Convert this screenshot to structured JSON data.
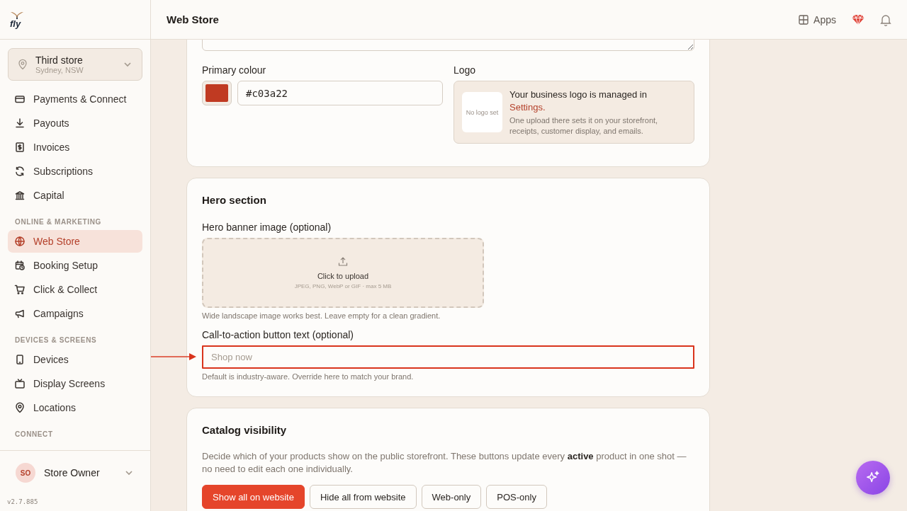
{
  "sidebar": {
    "brand": "fly",
    "store_selector": {
      "name": "Third store",
      "location": "Sydney, NSW"
    },
    "sections": [
      {
        "items": [
          {
            "label": "Payments & Connect",
            "selected": false
          },
          {
            "label": "Payouts",
            "selected": false
          },
          {
            "label": "Invoices",
            "selected": false
          },
          {
            "label": "Subscriptions",
            "selected": false
          },
          {
            "label": "Capital",
            "selected": false
          }
        ]
      },
      {
        "heading": "ONLINE & MARKETING",
        "items": [
          {
            "label": "Web Store",
            "selected": true
          },
          {
            "label": "Booking Setup",
            "selected": false
          },
          {
            "label": "Click & Collect",
            "selected": false
          },
          {
            "label": "Campaigns",
            "selected": false
          }
        ]
      },
      {
        "heading": "DEVICES & SCREENS",
        "items": [
          {
            "label": "Devices",
            "selected": false
          },
          {
            "label": "Display Screens",
            "selected": false
          },
          {
            "label": "Locations",
            "selected": false
          }
        ]
      },
      {
        "heading": "CONNECT"
      }
    ],
    "user": {
      "initials": "SO",
      "name": "Store Owner"
    },
    "version": "v2.7.885"
  },
  "header": {
    "title": "Web Store",
    "apps_label": "Apps"
  },
  "branding_card": {
    "primary_colour": {
      "label": "Primary colour",
      "value": "#c03a22",
      "color": "#c03a22"
    },
    "logo": {
      "label": "Logo",
      "placeholder": "No logo set",
      "message": "Your business logo is managed in",
      "link": "Settings.",
      "note": "One upload there sets it on your storefront, receipts, customer display, and emails."
    }
  },
  "hero_card": {
    "title": "Hero section",
    "banner": {
      "label": "Hero banner image (optional)",
      "action": "Click to upload",
      "hint": "JPEG, PNG, WebP or GIF · max 5 MB",
      "help": "Wide landscape image works best. Leave empty for a clean gradient."
    },
    "cta": {
      "label": "Call-to-action button text (optional)",
      "placeholder": "Shop now",
      "highlighted": true,
      "help": "Default is industry-aware. Override here to match your brand."
    }
  },
  "catalog_card": {
    "title": "Catalog visibility",
    "description": "Decide which of your products show on the public storefront. These buttons update every **active** product in one shot — no need to edit each one individually.",
    "buttons": [
      {
        "label": "Show all on website",
        "primary": true
      },
      {
        "label": "Hide all from website",
        "primary": false
      },
      {
        "label": "Web-only",
        "primary": false
      },
      {
        "label": "POS-only",
        "primary": false
      }
    ]
  }
}
